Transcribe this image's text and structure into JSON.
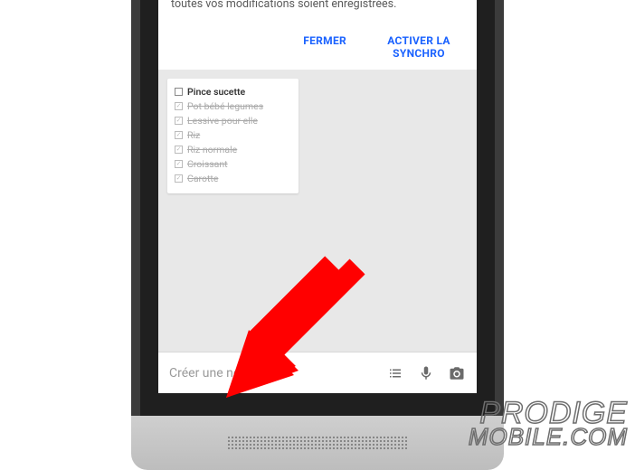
{
  "banner": {
    "message": "La synchronisation est désactivée. Réactivez-la pour que toutes vos modifications soient enregistrées.",
    "close_label": "FERMER",
    "enable_label": "ACTIVER LA SYNCHRO"
  },
  "note": {
    "items": [
      {
        "label": "Pince sucette",
        "done": false
      },
      {
        "label": "Pot bébé legumes",
        "done": true
      },
      {
        "label": "Lessive pour elle",
        "done": true
      },
      {
        "label": "Riz",
        "done": true
      },
      {
        "label": "Riz normale",
        "done": true
      },
      {
        "label": "Croissant",
        "done": true
      },
      {
        "label": "Carotte",
        "done": true
      }
    ]
  },
  "compose": {
    "placeholder": "Créer une note...",
    "icons": {
      "list": "list-icon",
      "mic": "mic-icon",
      "camera": "camera-icon"
    }
  },
  "watermark": {
    "line1": "PRODIGE",
    "line2": "MOBILE.COM"
  },
  "colors": {
    "accent": "#1a62ff",
    "arrow": "#ff0000"
  }
}
